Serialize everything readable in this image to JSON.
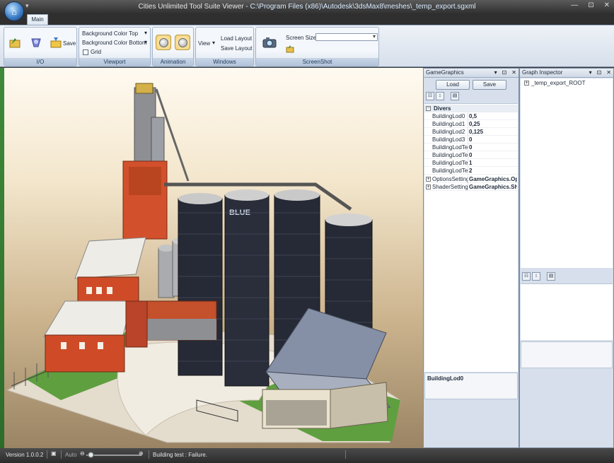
{
  "window": {
    "title": "Cities Unlimited Tool Suite Viewer",
    "separator": " - ",
    "path": "C:\\Program Files (x86)\\Autodesk\\3dsMax8\\meshes\\_temp_export.sgxml",
    "minimize": "—",
    "maximize": "⊡",
    "close": "✕"
  },
  "ribbon": {
    "tab": "Main",
    "io": {
      "label": "I/O",
      "save": "Save"
    },
    "viewport": {
      "label": "Viewport",
      "bg_top": "Background Color Top",
      "bg_bottom": "Background Color Bottom",
      "grid": "Grid"
    },
    "animation": {
      "label": "Animation"
    },
    "windows": {
      "label": "Windows",
      "view": "View",
      "load_layout": "Load Layout",
      "save_layout": "Save Layout"
    },
    "screenshot": {
      "label": "ScreenShot",
      "screen_size": "Screen Size",
      "screen_size_value": ""
    }
  },
  "gamegraphics": {
    "title": "GameGraphics",
    "load": "Load",
    "save": "Save",
    "category": "Divers",
    "rows": [
      {
        "key": "BuildingLod0",
        "value": "0,5"
      },
      {
        "key": "BuildingLod1",
        "value": "0,25"
      },
      {
        "key": "BuildingLod2",
        "value": "0,125"
      },
      {
        "key": "BuildingLod3",
        "value": "0"
      },
      {
        "key": "BuildingLodTec",
        "value": "0"
      },
      {
        "key": "BuildingLodTec",
        "value": "0"
      },
      {
        "key": "BuildingLodTec",
        "value": "1"
      },
      {
        "key": "BuildingLodTec",
        "value": "2"
      }
    ],
    "groups": [
      {
        "key": "OptionsSetting",
        "value": "GameGraphics.Opt"
      },
      {
        "key": "ShaderSetting:",
        "value": "GameGraphics.Sha"
      }
    ],
    "description": "BuildingLod0"
  },
  "graph_inspector": {
    "title": "Graph Inspector",
    "root": "_temp_export_ROOT"
  },
  "status": {
    "version": "Version 1.0.0.2",
    "auto": "Auto",
    "message": "Building test : Failure."
  },
  "colors": {
    "accent": "#3d7fc8",
    "highlight": "#f3cd6e",
    "building": "#d3502c",
    "silo": "#262a36"
  }
}
